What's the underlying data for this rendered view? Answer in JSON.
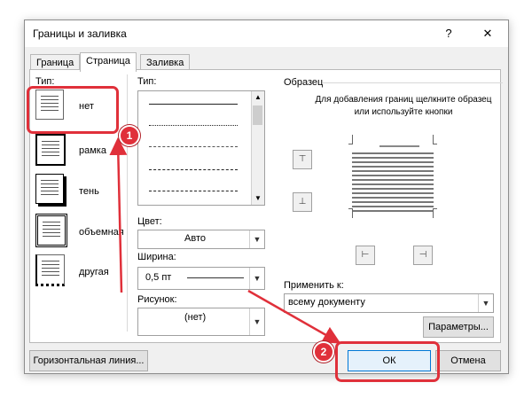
{
  "window": {
    "title": "Границы и заливка",
    "help": "?",
    "close": "✕"
  },
  "tabs": [
    {
      "label": "Граница",
      "u": "Г"
    },
    {
      "label": "Страница",
      "u": ""
    },
    {
      "label": "Заливка",
      "u": "З"
    }
  ],
  "type_section": {
    "label": "Тип:",
    "items": [
      {
        "label": "нет"
      },
      {
        "label": "рамка"
      },
      {
        "label": "тень"
      },
      {
        "label": "объемная"
      },
      {
        "label": "другая"
      }
    ]
  },
  "style_section": {
    "label": "Тип:"
  },
  "color": {
    "label": "Цвет:",
    "value": "Авто"
  },
  "width": {
    "label": "Ширина:",
    "value": "0,5 пт"
  },
  "art": {
    "label": "Рисунок:",
    "value": "(нет)"
  },
  "preview": {
    "label": "Образец",
    "hint": "Для добавления границ щелкните образец или используйте кнопки"
  },
  "apply_to": {
    "label": "Применить к:",
    "value": "всему документу"
  },
  "buttons": {
    "parameters": "Параметры...",
    "horizontal_line": "Горизонтальная линия...",
    "ok": "ОК",
    "cancel": "Отмена"
  },
  "annotations": {
    "badge1": "1",
    "badge2": "2",
    "color": "#e0303a"
  }
}
